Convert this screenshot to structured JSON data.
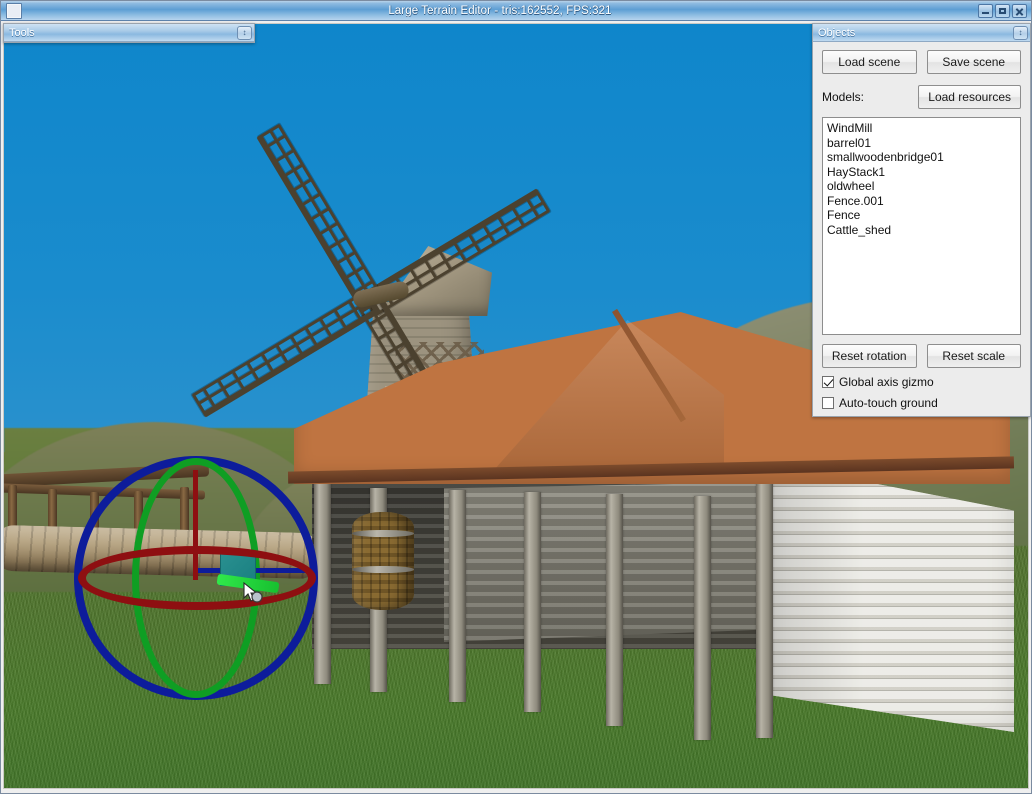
{
  "window": {
    "title": "Large Terrain Editor - tris:162552, FPS:321",
    "icon": "app-icon",
    "controls": {
      "minimize": "minimize-icon",
      "maximize": "maximize-icon",
      "close": "close-icon"
    }
  },
  "tools_panel": {
    "title": "Tools",
    "toggle_glyph": "↕",
    "collapsed": true
  },
  "objects_panel": {
    "title": "Objects",
    "toggle_glyph": "↕",
    "load_scene_label": "Load scene",
    "save_scene_label": "Save scene",
    "models_label": "Models:",
    "load_resources_label": "Load resources",
    "models": [
      "WindMill",
      "barrel01",
      "smallwoodenbridge01",
      "HayStack1",
      "oldwheel",
      "Fence.001",
      "Fence",
      "Cattle_shed"
    ],
    "reset_rotation_label": "Reset rotation",
    "reset_scale_label": "Reset scale",
    "checkboxes": [
      {
        "label": "Global axis gizmo",
        "checked": true
      },
      {
        "label": "Auto-touch ground",
        "checked": false
      }
    ]
  },
  "viewport": {
    "name": "3d-scene-viewport",
    "sky_color": "#1384c4",
    "ground_color": "#4b7b2b",
    "roof_color": "#bf7441",
    "gizmo": {
      "name": "rotation-gizmo",
      "ring_x_color": "#8e0f11",
      "ring_y_color": "#0f9e23",
      "ring_z_color": "#0d1c9b",
      "selection_box_color": "#1f8a8a",
      "active_handle_color": "#22d63c"
    },
    "objects_in_scene": [
      "windmill",
      "cattle-shed",
      "barrel",
      "wooden-bridge",
      "log",
      "terrain-hills",
      "grass-terrain"
    ]
  }
}
